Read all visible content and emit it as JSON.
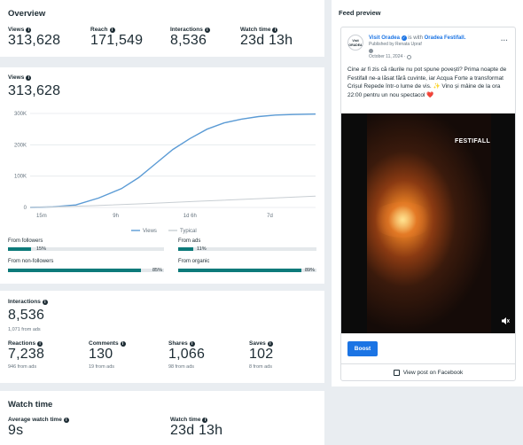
{
  "overview": {
    "title": "Overview",
    "stats": [
      {
        "label": "Views",
        "value": "313,628"
      },
      {
        "label": "Reach",
        "value": "171,549"
      },
      {
        "label": "Interactions",
        "value": "8,536"
      },
      {
        "label": "Watch time",
        "value": "23d 13h"
      }
    ]
  },
  "views": {
    "label": "Views",
    "value": "313,628",
    "legend": {
      "views": "Views",
      "typical": "Typical"
    },
    "followers": {
      "label": "From followers",
      "pct": "15%",
      "fraction": 0.15
    },
    "non_followers": {
      "label": "From non-followers",
      "pct": "85%",
      "fraction": 0.85
    },
    "ads": {
      "label": "From ads",
      "pct": "11%",
      "fraction": 0.11
    },
    "organic": {
      "label": "From organic",
      "pct": "89%",
      "fraction": 0.89
    }
  },
  "chart_data": {
    "type": "line",
    "title": "",
    "xlabel": "",
    "ylabel": "",
    "x_ticks": [
      "15m",
      "9h",
      "1d 6h",
      "7d"
    ],
    "y_ticks": [
      "0",
      "100K",
      "200K",
      "300K"
    ],
    "ylim": [
      0,
      300000
    ],
    "grid": true,
    "legend_position": "bottom",
    "series": [
      {
        "name": "Views",
        "color": "#5b9bd5",
        "x": [
          0,
          0.08,
          0.16,
          0.24,
          0.32,
          0.38,
          0.44,
          0.5,
          0.56,
          0.62,
          0.68,
          0.74,
          0.8,
          0.86,
          0.92,
          1.0
        ],
        "values": [
          0,
          2000,
          8000,
          30000,
          60000,
          95000,
          140000,
          185000,
          220000,
          250000,
          270000,
          282000,
          290000,
          295000,
          296500,
          298000
        ]
      },
      {
        "name": "Typical",
        "color": "#c8ced3",
        "x": [
          0,
          0.2,
          0.4,
          0.6,
          0.8,
          1.0
        ],
        "values": [
          0,
          5000,
          12000,
          20000,
          28000,
          36000
        ]
      }
    ]
  },
  "interactions": {
    "label": "Interactions",
    "value": "8,536",
    "sub": "1,071 from ads",
    "items": [
      {
        "label": "Reactions",
        "value": "7,238",
        "sub": "946 from ads"
      },
      {
        "label": "Comments",
        "value": "130",
        "sub": "19 from ads"
      },
      {
        "label": "Shares",
        "value": "1,066",
        "sub": "98 from ads"
      },
      {
        "label": "Saves",
        "value": "102",
        "sub": "8 from ads"
      }
    ]
  },
  "watch": {
    "title": "Watch time",
    "items": [
      {
        "label": "Average watch time",
        "value": "9s"
      },
      {
        "label": "Watch time",
        "value": "23d 13h"
      }
    ]
  },
  "feed": {
    "title": "Feed preview",
    "page_name": "Visit Oradea",
    "with_text": "is with",
    "partner": "Oradea Festifall.",
    "published_by": "Published by Renata Upraf",
    "date": "October 11, 2024 ·",
    "more": "···",
    "avatar_text": "Visit ORADEA",
    "text": "Cine ar fi zis că râurile nu pot spune povești? Prima noapte de Festifall ne-a lăsat fără cuvinte, iar Acqua Forte a transformat Crișul Repede într-o lume de vis. ✨ Vino și mâine de la ora 22:00 pentru un nou spectacol ❤️",
    "video_overlay": "FESTIFALL",
    "boost": "Boost",
    "view_post": "View post on Facebook"
  }
}
